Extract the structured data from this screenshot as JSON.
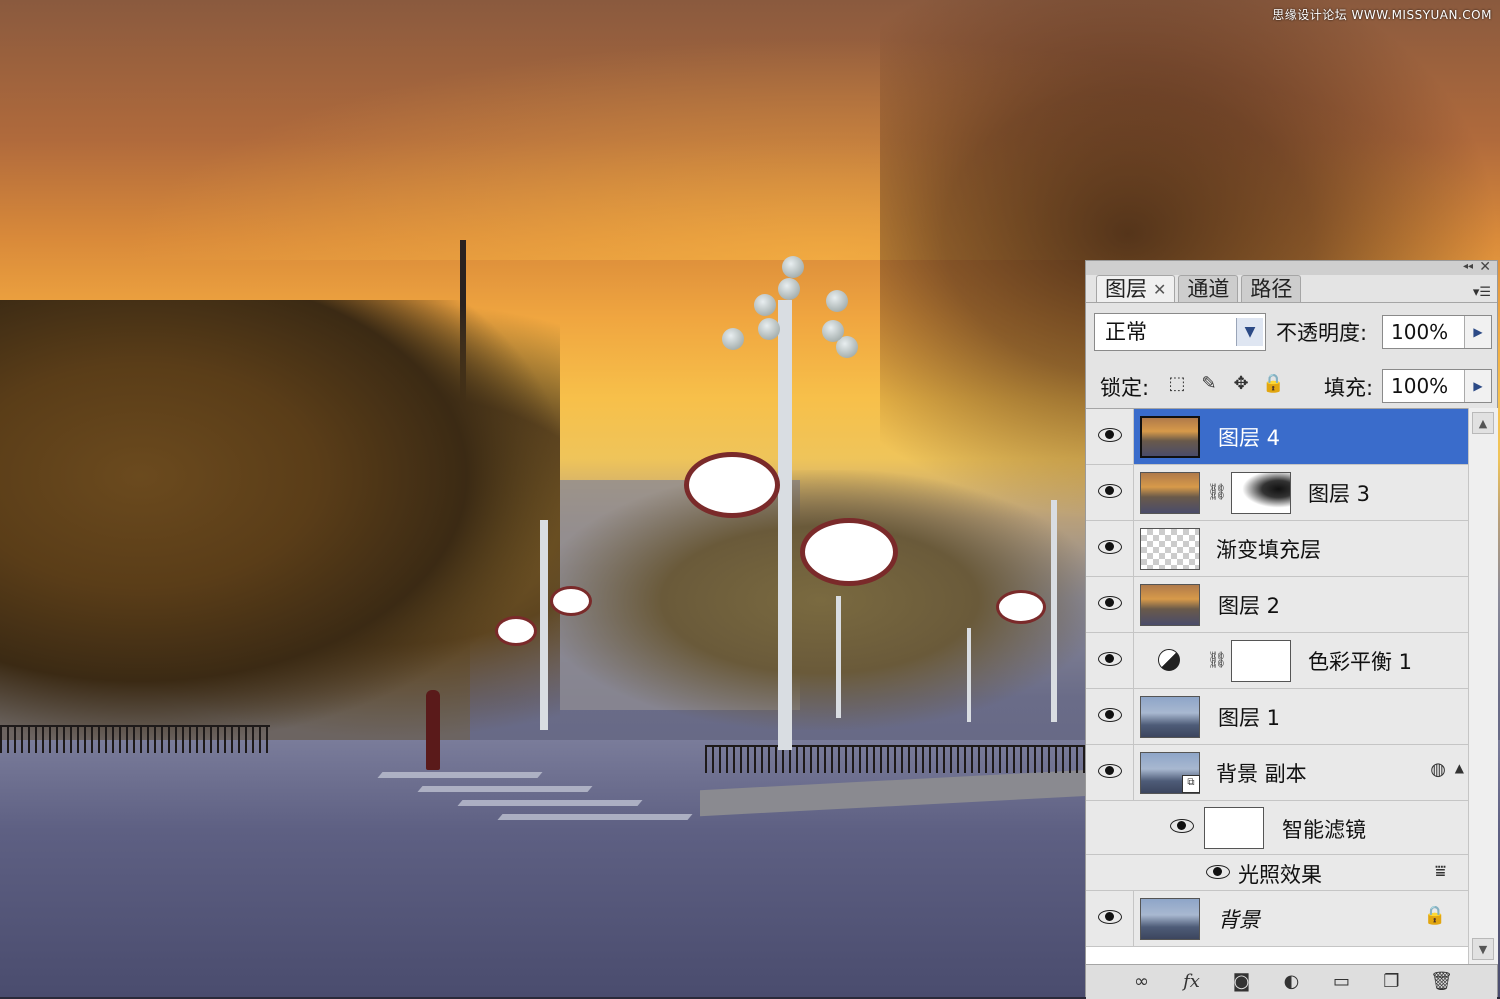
{
  "watermark": "思缘设计论坛 WWW.MISSYUAN.COM",
  "panel": {
    "tabs": [
      {
        "label": "图层",
        "active": true
      },
      {
        "label": "通道",
        "active": false
      },
      {
        "label": "路径",
        "active": false
      }
    ],
    "close_glyph": "✕",
    "collapse_glyph": "◂◂",
    "menu_glyph": "▾☰",
    "blend_mode": "正常",
    "opacity_label": "不透明度:",
    "opacity_value": "100%",
    "lock_label": "锁定:",
    "fill_label": "填充:",
    "fill_value": "100%",
    "lock_icons": [
      "lock-transparent-icon",
      "brush-icon",
      "move-icon",
      "lock-icon"
    ],
    "layers": [
      {
        "name": "图层 4",
        "selected": true,
        "thumb": "photo"
      },
      {
        "name": "图层 3",
        "selected": false,
        "thumb": "photo",
        "mask": true
      },
      {
        "name": "渐变填充层",
        "selected": false,
        "thumb": "checker"
      },
      {
        "name": "图层 2",
        "selected": false,
        "thumb": "photo"
      },
      {
        "name": "色彩平衡 1",
        "selected": false,
        "thumb": "white",
        "adjustment": true
      },
      {
        "name": "图层 1",
        "selected": false,
        "thumb": "blue"
      },
      {
        "name": "背景 副本",
        "selected": false,
        "thumb": "blue",
        "smart_object": true
      },
      {
        "name": "智能滤镜",
        "selected": false,
        "thumb": "white",
        "sub": true
      },
      {
        "name": "光照效果",
        "selected": false,
        "filter": true
      },
      {
        "name": "背景",
        "selected": false,
        "thumb": "blue",
        "locked": true
      }
    ],
    "bottom_icons": [
      "link-icon",
      "fx-icon",
      "mask-icon",
      "adjustment-icon",
      "folder-icon",
      "new-layer-icon",
      "trash-icon"
    ]
  },
  "colors": {
    "selection": "#3a6ccb",
    "panel_bg": "#e4e4e4"
  }
}
